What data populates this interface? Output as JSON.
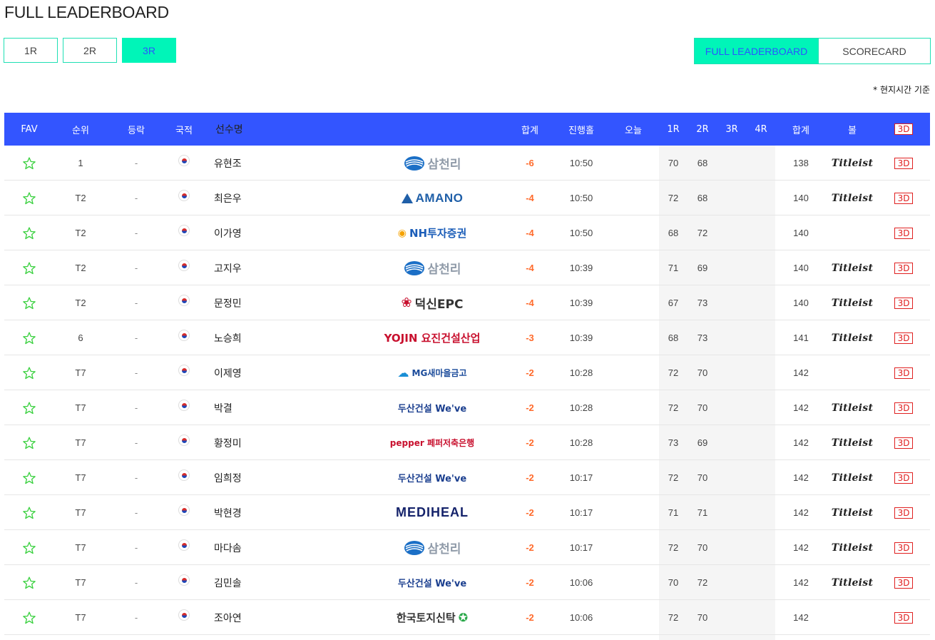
{
  "page_title": "FULL LEADERBOARD",
  "round_tabs": [
    {
      "label": "1R",
      "active": false
    },
    {
      "label": "2R",
      "active": false
    },
    {
      "label": "3R",
      "active": true
    }
  ],
  "view_tabs": [
    {
      "label": "FULL LEADERBOARD",
      "active": true
    },
    {
      "label": "SCORECARD",
      "active": false
    }
  ],
  "timezone_note": "* 현지시간 기준",
  "columns": {
    "fav": "FAV",
    "rank": "순위",
    "move": "등락",
    "nation": "국적",
    "name": "선수명",
    "total": "합계",
    "thru": "진행홀",
    "today": "오늘",
    "r1": "1R",
    "r2": "2R",
    "r3": "3R",
    "r4": "4R",
    "sum": "합계",
    "ball": "볼",
    "view3d": "3D"
  },
  "colors": {
    "header_bg": "#3355ff",
    "accent_tab": "#00f5b8",
    "score_under": "#ff6a2b",
    "badge_red": "#e02020"
  },
  "rows": [
    {
      "rank": "1",
      "move": "-",
      "name": "유현조",
      "sponsor": "삼천리",
      "total": "-6",
      "thru": "10:50",
      "today": "",
      "r1": "70",
      "r2": "68",
      "r3": "",
      "r4": "",
      "sum": "138",
      "ball": "Titleist",
      "view3d": "3D"
    },
    {
      "rank": "T2",
      "move": "-",
      "name": "최은우",
      "sponsor": "AMANO",
      "total": "-4",
      "thru": "10:50",
      "today": "",
      "r1": "72",
      "r2": "68",
      "r3": "",
      "r4": "",
      "sum": "140",
      "ball": "Titleist",
      "view3d": "3D"
    },
    {
      "rank": "T2",
      "move": "-",
      "name": "이가영",
      "sponsor": "NH투자증권",
      "total": "-4",
      "thru": "10:50",
      "today": "",
      "r1": "68",
      "r2": "72",
      "r3": "",
      "r4": "",
      "sum": "140",
      "ball": "",
      "view3d": "3D"
    },
    {
      "rank": "T2",
      "move": "-",
      "name": "고지우",
      "sponsor": "삼천리",
      "total": "-4",
      "thru": "10:39",
      "today": "",
      "r1": "71",
      "r2": "69",
      "r3": "",
      "r4": "",
      "sum": "140",
      "ball": "Titleist",
      "view3d": "3D"
    },
    {
      "rank": "T2",
      "move": "-",
      "name": "문정민",
      "sponsor": "덕신EPC",
      "total": "-4",
      "thru": "10:39",
      "today": "",
      "r1": "67",
      "r2": "73",
      "r3": "",
      "r4": "",
      "sum": "140",
      "ball": "Titleist",
      "view3d": "3D"
    },
    {
      "rank": "6",
      "move": "-",
      "name": "노승희",
      "sponsor": "YOJIN 요진건설산업",
      "total": "-3",
      "thru": "10:39",
      "today": "",
      "r1": "68",
      "r2": "73",
      "r3": "",
      "r4": "",
      "sum": "141",
      "ball": "Titleist",
      "view3d": "3D"
    },
    {
      "rank": "T7",
      "move": "-",
      "name": "이제영",
      "sponsor": "MG새마을금고",
      "total": "-2",
      "thru": "10:28",
      "today": "",
      "r1": "72",
      "r2": "70",
      "r3": "",
      "r4": "",
      "sum": "142",
      "ball": "",
      "view3d": "3D"
    },
    {
      "rank": "T7",
      "move": "-",
      "name": "박결",
      "sponsor": "두산건설 We've",
      "total": "-2",
      "thru": "10:28",
      "today": "",
      "r1": "72",
      "r2": "70",
      "r3": "",
      "r4": "",
      "sum": "142",
      "ball": "Titleist",
      "view3d": "3D"
    },
    {
      "rank": "T7",
      "move": "-",
      "name": "황정미",
      "sponsor": "pepper 페퍼저축은행",
      "total": "-2",
      "thru": "10:28",
      "today": "",
      "r1": "73",
      "r2": "69",
      "r3": "",
      "r4": "",
      "sum": "142",
      "ball": "Titleist",
      "view3d": "3D"
    },
    {
      "rank": "T7",
      "move": "-",
      "name": "임희정",
      "sponsor": "두산건설 We've",
      "total": "-2",
      "thru": "10:17",
      "today": "",
      "r1": "72",
      "r2": "70",
      "r3": "",
      "r4": "",
      "sum": "142",
      "ball": "Titleist",
      "view3d": "3D"
    },
    {
      "rank": "T7",
      "move": "-",
      "name": "박현경",
      "sponsor": "MEDIHEAL",
      "total": "-2",
      "thru": "10:17",
      "today": "",
      "r1": "71",
      "r2": "71",
      "r3": "",
      "r4": "",
      "sum": "142",
      "ball": "Titleist",
      "view3d": "3D"
    },
    {
      "rank": "T7",
      "move": "-",
      "name": "마다솜",
      "sponsor": "삼천리",
      "total": "-2",
      "thru": "10:17",
      "today": "",
      "r1": "72",
      "r2": "70",
      "r3": "",
      "r4": "",
      "sum": "142",
      "ball": "Titleist",
      "view3d": "3D"
    },
    {
      "rank": "T7",
      "move": "-",
      "name": "김민솔",
      "sponsor": "두산건설 We've",
      "total": "-2",
      "thru": "10:06",
      "today": "",
      "r1": "70",
      "r2": "72",
      "r3": "",
      "r4": "",
      "sum": "142",
      "ball": "Titleist",
      "view3d": "3D"
    },
    {
      "rank": "T7",
      "move": "-",
      "name": "조아연",
      "sponsor": "한국토지신탁",
      "total": "-2",
      "thru": "10:06",
      "today": "",
      "r1": "72",
      "r2": "70",
      "r3": "",
      "r4": "",
      "sum": "142",
      "ball": "",
      "view3d": "3D"
    }
  ]
}
